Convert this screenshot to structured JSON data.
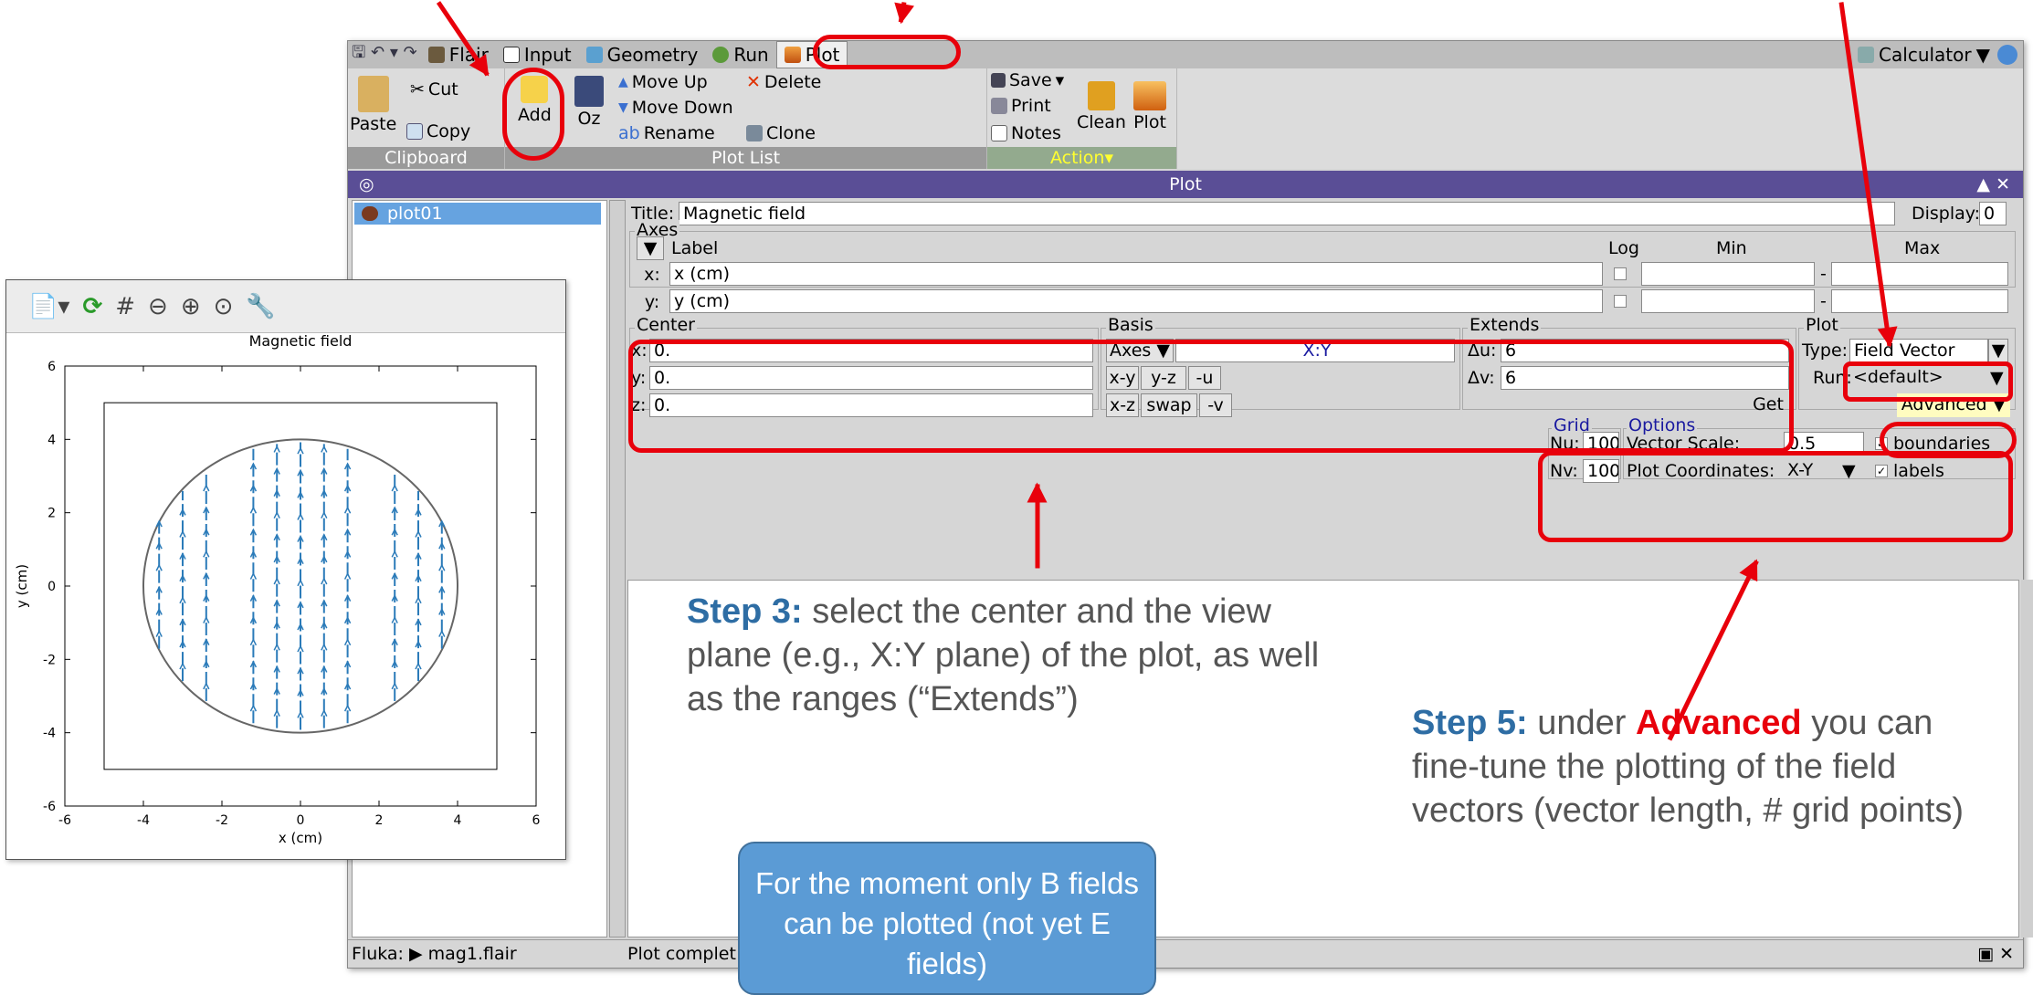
{
  "menubar": {
    "items": [
      {
        "label": "Flair",
        "icon": "flair-icon"
      },
      {
        "label": "Input",
        "icon": "input-icon"
      },
      {
        "label": "Geometry",
        "icon": "geometry-icon"
      },
      {
        "label": "Run",
        "icon": "run-icon"
      },
      {
        "label": "Plot",
        "icon": "plot-icon"
      }
    ],
    "calculator": "Calculator"
  },
  "ribbon": {
    "paste": "Paste",
    "cut": "Cut",
    "copy": "Copy",
    "add": "Add",
    "oz": "Oz",
    "move_up": "Move Up",
    "move_down": "Move Down",
    "rename": "Rename",
    "delete": "Delete",
    "clone": "Clone",
    "save": "Save",
    "print": "Print",
    "notes": "Notes",
    "clean": "Clean",
    "plot": "Plot",
    "group_clipboard": "Clipboard",
    "group_plotlist": "Plot List",
    "group_action": "Action"
  },
  "panel_title": "Plot",
  "plot_list": [
    "plot01"
  ],
  "form": {
    "title_label": "Title:",
    "title_value": "Magnetic field",
    "display_label": "Display:",
    "display_value": "0",
    "axes_label": "Axes",
    "label_header": "Label",
    "log_header": "Log",
    "min_header": "Min",
    "max_header": "Max",
    "x_axis_label": "x:",
    "x_axis_value": "x (cm)",
    "y_axis_label": "y:",
    "y_axis_value": "y (cm)",
    "center_label": "Center",
    "center_x_label": "x:",
    "center_x": "0.",
    "center_y_label": "y:",
    "center_y": "0.",
    "center_z_label": "z:",
    "center_z": "0.",
    "basis_label": "Basis",
    "basis_axes": "Axes",
    "basis_plane": "X:Y",
    "btn_xy": "x-y",
    "btn_yz": "y-z",
    "btn_u": "-u",
    "btn_xz": "x-z",
    "btn_swap": "swap",
    "btn_v": "-v",
    "extends_label": "Extends",
    "du_label": "Δu:",
    "du": "6",
    "dv_label": "Δv:",
    "dv": "6",
    "get": "Get",
    "plot_label": "Plot",
    "type_label": "Type:",
    "type_value": "Field Vector",
    "run_label": "Run:",
    "run_value": "<default>",
    "advanced": "Advanced",
    "grid_label": "Grid",
    "nu_label": "Nu:",
    "nu": "100",
    "nv_label": "Nv:",
    "nv": "100",
    "options_label": "Options",
    "vector_scale_label": "Vector Scale:",
    "vector_scale": "0.5",
    "boundaries": "boundaries",
    "plot_coords_label": "Plot Coordinates:",
    "plot_coords": "X-Y",
    "labels": "labels"
  },
  "status": {
    "left": "Fluka: ▶ mag1.flair",
    "right": "Plot complet"
  },
  "annotations": {
    "step3_bold": "Step 3:",
    "step3_text": " select the center and the view plane (e.g., X:Y plane) of the plot, as well as the ranges (“Extends”)",
    "step5_bold": "Step 5:",
    "step5_pre": " under ",
    "step5_adv": "Advanced",
    "step5_text": " you can fine-tune the plotting of the field vectors (vector length, # grid points)",
    "callout": "For the moment only B fields can be plotted (not yet E fields)"
  },
  "chart_data": {
    "type": "vector_field",
    "title": "Magnetic field",
    "xlabel": "x (cm)",
    "ylabel": "y (cm)",
    "xlim": [
      -6,
      6
    ],
    "ylim": [
      -6,
      6
    ],
    "xticks": [
      "-6",
      "-4",
      "-2",
      "0",
      "2",
      "4",
      "6"
    ],
    "yticks": [
      "-6",
      "-4",
      "-2",
      "0",
      "2",
      "4",
      "6"
    ],
    "region": {
      "shape": "circle",
      "center": [
        0,
        0
      ],
      "radius": 4
    },
    "box": [
      [
        -5,
        -5
      ],
      [
        5,
        5
      ]
    ],
    "vector_columns_x": [
      -3.6,
      -3.0,
      -2.4,
      -1.2,
      -0.6,
      0,
      0.6,
      1.2,
      2.4,
      3.0,
      3.6
    ],
    "vector_direction": "+y"
  }
}
